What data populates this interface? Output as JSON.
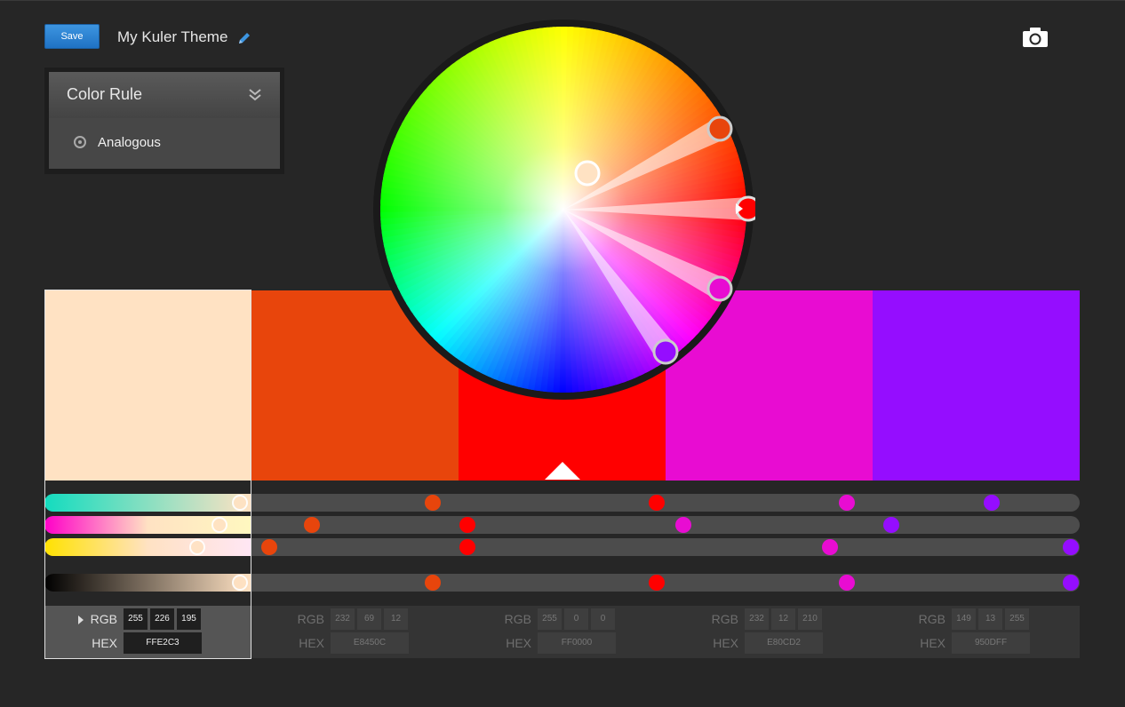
{
  "header": {
    "save_label": "Save",
    "theme_title": "My Kuler Theme",
    "edit_icon": "pencil-icon",
    "camera_icon": "camera-icon"
  },
  "color_rule": {
    "title": "Color Rule",
    "selected_option": "Analogous",
    "chevron_icon": "double-chevron-down-icon",
    "radio_icon": "radio-icon"
  },
  "swatches": [
    {
      "hex_color": "#FFE2C3",
      "r": "255",
      "g": "226",
      "b": "195",
      "hex": "FFE2C3",
      "active": true
    },
    {
      "hex_color": "#E8450C",
      "r": "232",
      "g": "69",
      "b": "12",
      "hex": "E8450C",
      "active": false
    },
    {
      "hex_color": "#FF0000",
      "r": "255",
      "g": "0",
      "b": "0",
      "hex": "FF0000",
      "active": false
    },
    {
      "hex_color": "#E80CD2",
      "r": "232",
      "g": "12",
      "b": "210",
      "hex": "E80CD2",
      "active": false
    },
    {
      "hex_color": "#950DFF",
      "r": "149",
      "g": "13",
      "b": "255",
      "hex": "950DFF",
      "active": false
    }
  ],
  "labels": {
    "rgb": "RGB",
    "hex": "HEX"
  },
  "base_color_index": 2
}
